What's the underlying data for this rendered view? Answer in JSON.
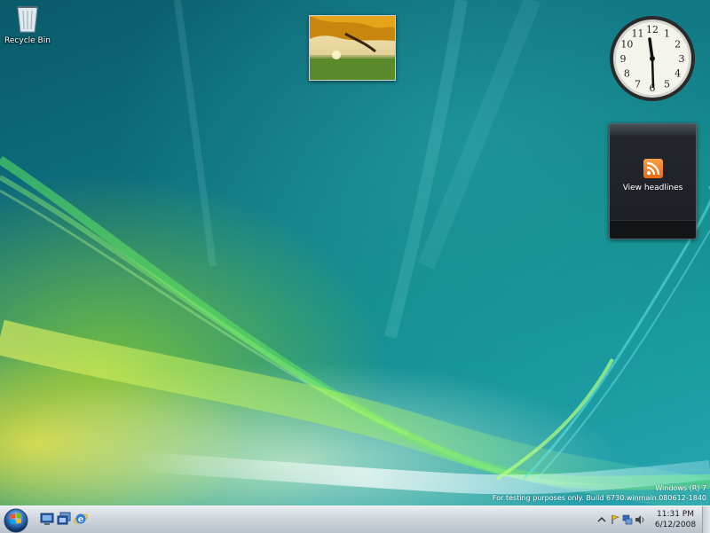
{
  "desktop": {
    "icons": [
      {
        "label": "Recycle Bin",
        "icon": "recycle-bin-icon"
      }
    ]
  },
  "gadgets": {
    "slideshow": {
      "icon": "autumn-tree-photo"
    },
    "clock": {
      "icon": "analog-clock",
      "numerals": [
        "1",
        "2",
        "3",
        "4",
        "5",
        "6",
        "7",
        "8",
        "9",
        "10",
        "11",
        "12"
      ]
    },
    "feed": {
      "caption": "View headlines",
      "icon": "rss-icon"
    }
  },
  "watermark": {
    "line1": "Windows (R) 7",
    "line2": "For testing purposes only. Build 6730.winmain.080612-1840"
  },
  "taskbar": {
    "start_icon": "windows-orb-icon",
    "quick_launch": [
      {
        "icon": "show-desktop-icon"
      },
      {
        "icon": "switch-windows-icon"
      },
      {
        "icon": "internet-explorer-icon"
      }
    ],
    "tray": {
      "icons": [
        "chevron-up-icon",
        "action-center-icon",
        "network-icon",
        "volume-icon"
      ],
      "time": "11:31 PM",
      "date": "6/12/2008"
    }
  },
  "colors": {
    "taskbar": "#cfd6dc",
    "desktop_teal": "#12888a",
    "desktop_yellow": "#d8d840",
    "rss_orange": "#f08a24"
  }
}
